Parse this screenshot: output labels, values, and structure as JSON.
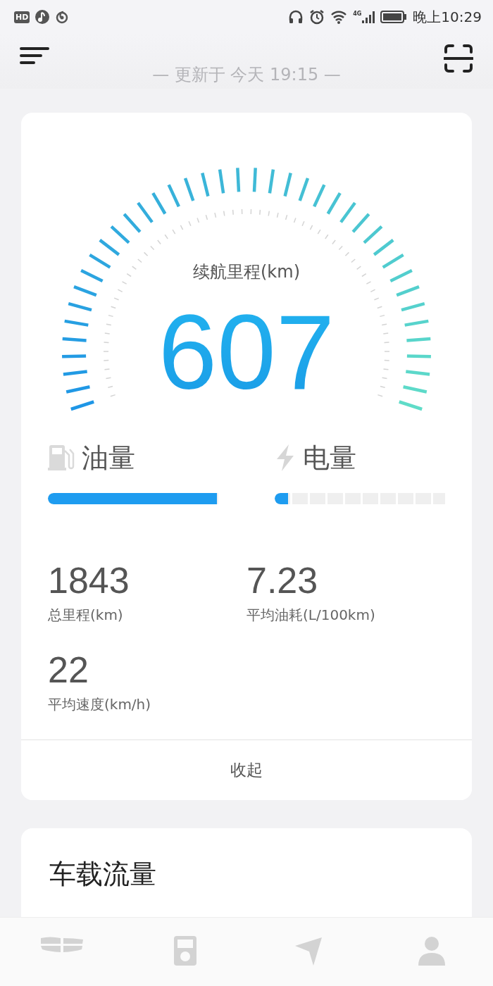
{
  "status_bar": {
    "hd_badge": "HD",
    "network": "4G",
    "time": "晚上10:29"
  },
  "header": {
    "update_note": "— 更新于 今天 19:15 —"
  },
  "range": {
    "label": "续航里程(km)",
    "value": "607"
  },
  "levels": [
    {
      "kind": "fuel",
      "label": "油量",
      "level": 0.99
    },
    {
      "kind": "electric",
      "label": "电量",
      "level": 0.08
    }
  ],
  "stats": [
    {
      "value": "1843",
      "label": "总里程(km)"
    },
    {
      "value": "7.23",
      "label": "平均油耗(L/100km)"
    },
    {
      "value": "22",
      "label": "平均速度(km/h)"
    }
  ],
  "collapse_button": "收起",
  "next_card": {
    "title": "车载流量"
  },
  "bottom_nav": [
    {
      "kind": "car"
    },
    {
      "kind": "device"
    },
    {
      "kind": "navigation"
    },
    {
      "kind": "profile"
    }
  ]
}
